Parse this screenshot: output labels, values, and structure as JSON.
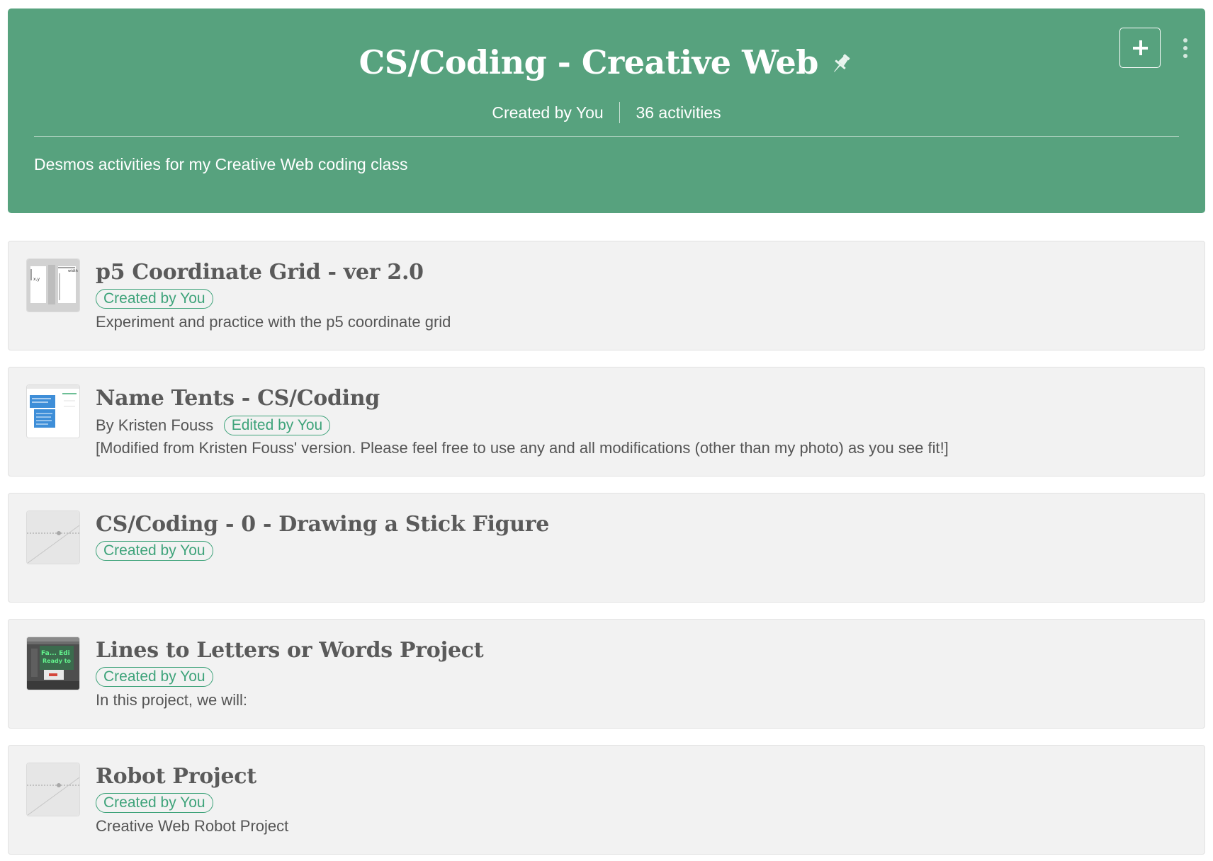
{
  "collection": {
    "title": "CS/Coding - Creative Web",
    "creator": "Created by You",
    "activity_count": "36 activities",
    "description": "Desmos activities for my Creative Web coding class",
    "colors": {
      "header_bg": "#57a27e",
      "tag": "#3ea37a"
    },
    "icons": {
      "pin": "pin-icon",
      "add": "plus-icon",
      "more": "more-vertical-icon"
    }
  },
  "activities": [
    {
      "title": "p5 Coordinate Grid - ver 2.0",
      "author": "",
      "tag": "Created by You",
      "description": "Experiment and practice with the p5 coordinate grid",
      "thumbnail": "coordinate-grid-thumbnail"
    },
    {
      "title": "Name Tents - CS/Coding",
      "author": "By Kristen Fouss",
      "tag": "Edited by You",
      "description": "[Modified from Kristen Fouss' version.  Please feel free to use any and all modifications (other than my photo) as you see fit!]",
      "thumbnail": "name-tents-thumbnail"
    },
    {
      "title": "CS/Coding - 0 - Drawing a Stick Figure",
      "author": "",
      "tag": "Created by You",
      "description": "",
      "thumbnail": "graph-placeholder-thumbnail"
    },
    {
      "title": "Lines to Letters or Words Project",
      "author": "",
      "tag": "Created by You",
      "description": "In this project, we will:",
      "thumbnail": "project-screenshot-thumbnail"
    },
    {
      "title": "Robot Project",
      "author": "",
      "tag": "Created by You",
      "description": "Creative Web Robot Project",
      "thumbnail": "graph-placeholder-thumbnail"
    }
  ]
}
